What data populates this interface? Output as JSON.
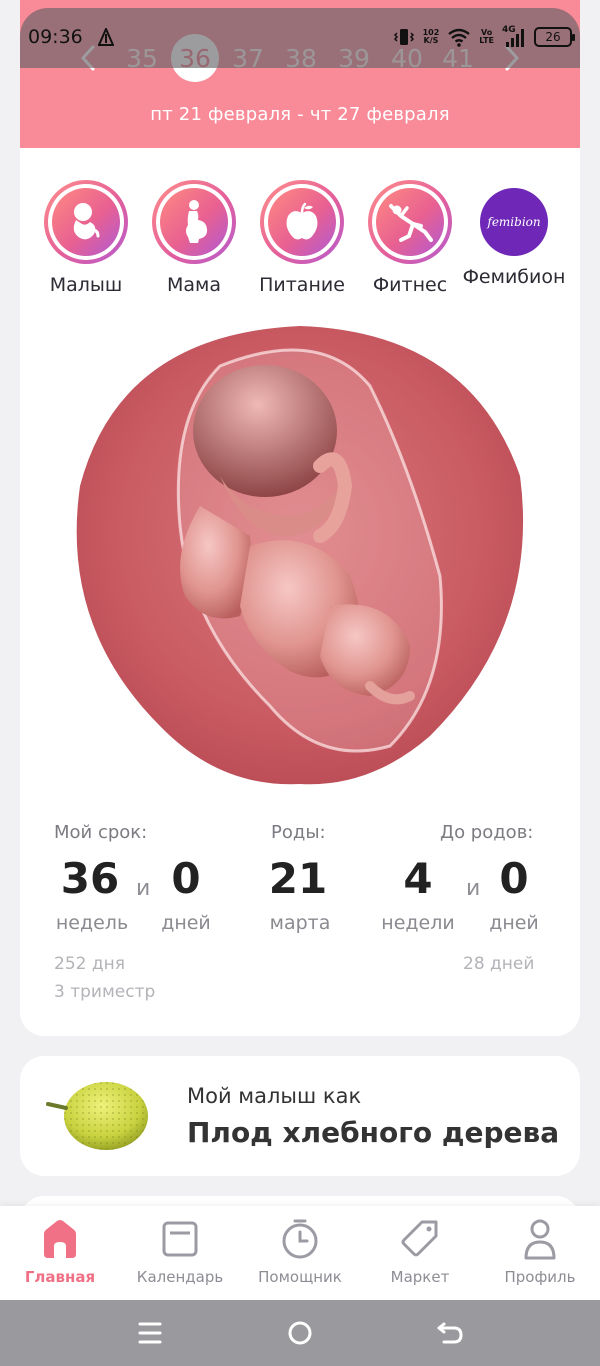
{
  "status_bar": {
    "time": "09:36",
    "net_speed_value": "102",
    "net_speed_unit": "K/S",
    "volte_top": "Vo",
    "volte_bottom": "LTE",
    "network": "4G",
    "battery": "26"
  },
  "week_selector": {
    "weeks": [
      "35",
      "36",
      "37",
      "38",
      "39",
      "40",
      "41"
    ],
    "selected_week": "36",
    "date_range": "пт 21 февраля - чт 27 февраля"
  },
  "categories": [
    {
      "label": "Малыш",
      "icon": "baby-icon"
    },
    {
      "label": "Мама",
      "icon": "pregnant-woman-icon"
    },
    {
      "label": "Питание",
      "icon": "apple-icon"
    },
    {
      "label": "Фитнес",
      "icon": "fitness-icon"
    },
    {
      "label": "Фемибион",
      "icon": "femibion-logo",
      "logo_text": "femibion"
    }
  ],
  "pregnancy_stats": {
    "term_label": "Мой срок:",
    "weeks_value": "36",
    "weeks_unit": "недель",
    "and_1": "и",
    "days_value": "0",
    "days_unit": "дней",
    "due_label": "Роды:",
    "due_day": "21",
    "due_month": "марта",
    "until_label": "До родов:",
    "until_weeks_value": "4",
    "until_weeks_unit": "недели",
    "and_2": "и",
    "until_days_value": "0",
    "until_days_unit": "дней",
    "total_days": "252 дня",
    "trimester": "3 триместр",
    "remaining_days": "28 дней"
  },
  "fruit_card": {
    "subtitle": "Мой малыш как",
    "title": "Плод хлебного дерева"
  },
  "bottom_nav": [
    {
      "label": "Главная",
      "icon": "home-icon",
      "active": true
    },
    {
      "label": "Календарь",
      "icon": "calendar-icon",
      "active": false
    },
    {
      "label": "Помощник",
      "icon": "timer-icon",
      "active": false
    },
    {
      "label": "Маркет",
      "icon": "tag-icon",
      "active": false
    },
    {
      "label": "Профиль",
      "icon": "profile-icon",
      "active": false
    }
  ],
  "colors": {
    "header_pink": "#f98b99",
    "active_nav": "#f07085",
    "femibion_purple": "#6e27b6"
  }
}
